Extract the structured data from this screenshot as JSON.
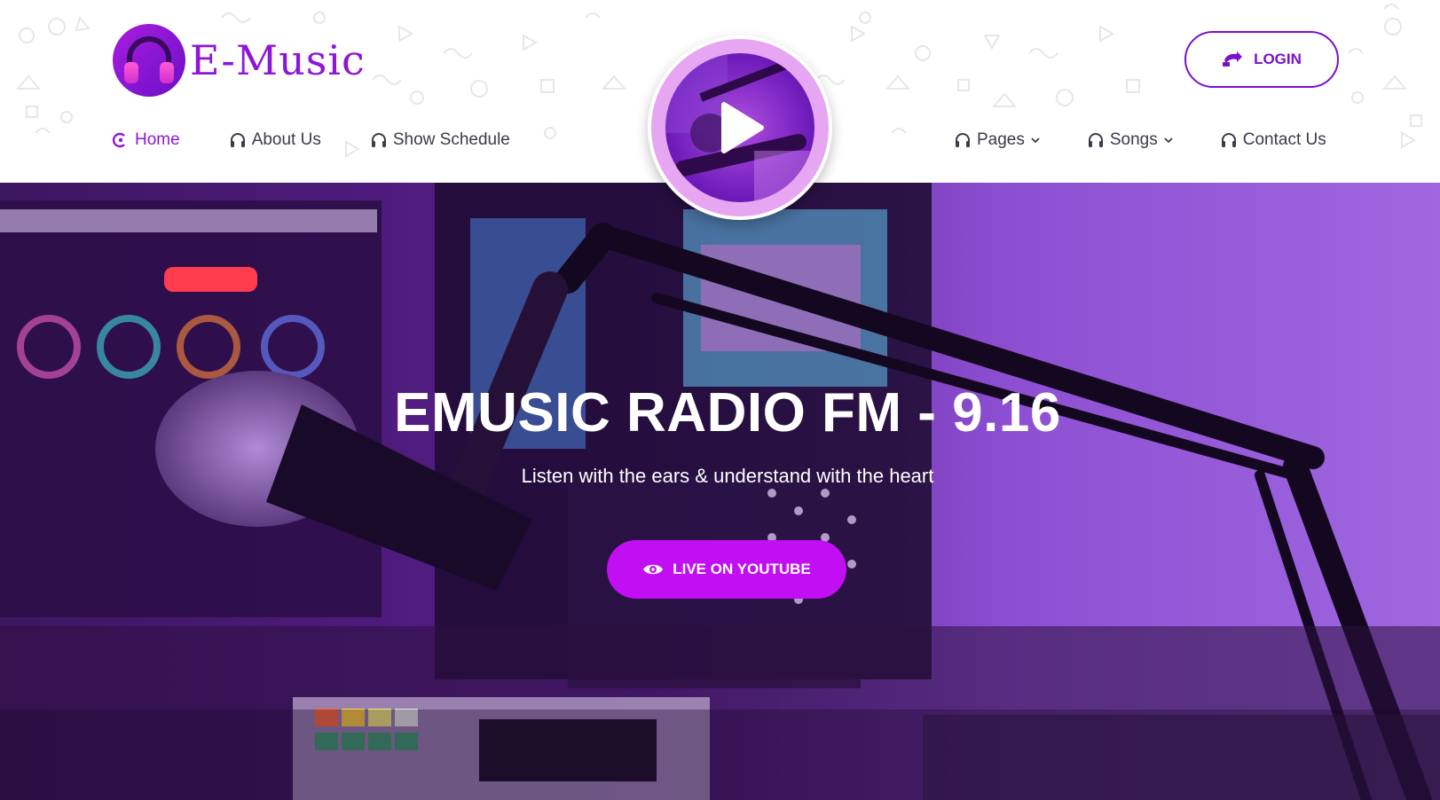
{
  "brand": {
    "name": "E-Music",
    "accent": "#8e16d8",
    "button_color": "#c20ef2"
  },
  "header": {
    "login_label": "LOGIN",
    "nav_left": [
      {
        "label": "Home",
        "icon": "radio-icon",
        "active": true
      },
      {
        "label": "About Us",
        "icon": "headphones-icon"
      },
      {
        "label": "Show Schedule",
        "icon": "headphones-icon"
      }
    ],
    "nav_right": [
      {
        "label": "Pages",
        "icon": "headphones-icon",
        "dropdown": true
      },
      {
        "label": "Songs",
        "icon": "headphones-icon",
        "dropdown": true
      },
      {
        "label": "Contact Us",
        "icon": "headphones-icon"
      }
    ]
  },
  "player": {
    "icon": "play-icon"
  },
  "hero": {
    "title": "EMUSIC RADIO FM - 9.16",
    "subtitle": "Listen with the ears & understand with the heart",
    "button_label": "LIVE ON YOUTUBE",
    "button_icon": "eye-icon"
  }
}
